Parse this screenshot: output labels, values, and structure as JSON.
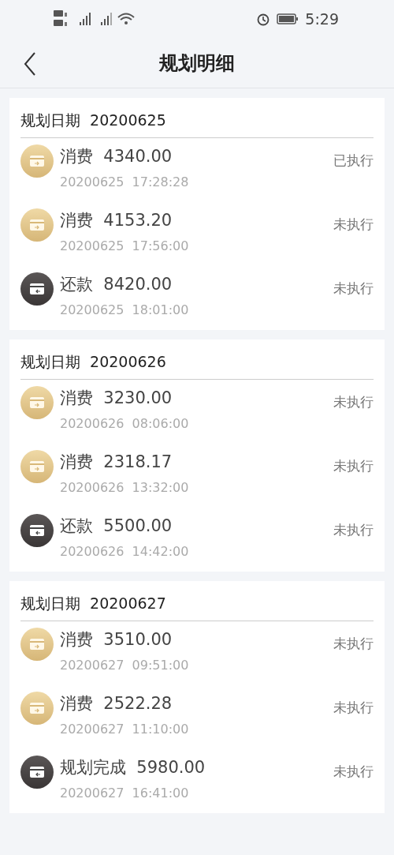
{
  "status_bar": {
    "time": "5:29"
  },
  "header": {
    "title": "规划明细"
  },
  "groups": [
    {
      "label": "规划日期",
      "date": "20200625",
      "items": [
        {
          "kind": "spend",
          "type": "消费",
          "amount": "4340.00",
          "date": "20200625",
          "time": "17:28:28",
          "status": "已执行"
        },
        {
          "kind": "spend",
          "type": "消费",
          "amount": "4153.20",
          "date": "20200625",
          "time": "17:56:00",
          "status": "未执行"
        },
        {
          "kind": "repay",
          "type": "还款",
          "amount": "8420.00",
          "date": "20200625",
          "time": "18:01:00",
          "status": "未执行"
        }
      ]
    },
    {
      "label": "规划日期",
      "date": "20200626",
      "items": [
        {
          "kind": "spend",
          "type": "消费",
          "amount": "3230.00",
          "date": "20200626",
          "time": "08:06:00",
          "status": "未执行"
        },
        {
          "kind": "spend",
          "type": "消费",
          "amount": "2318.17",
          "date": "20200626",
          "time": "13:32:00",
          "status": "未执行"
        },
        {
          "kind": "repay",
          "type": "还款",
          "amount": "5500.00",
          "date": "20200626",
          "time": "14:42:00",
          "status": "未执行"
        }
      ]
    },
    {
      "label": "规划日期",
      "date": "20200627",
      "items": [
        {
          "kind": "spend",
          "type": "消费",
          "amount": "3510.00",
          "date": "20200627",
          "time": "09:51:00",
          "status": "未执行"
        },
        {
          "kind": "spend",
          "type": "消费",
          "amount": "2522.28",
          "date": "20200627",
          "time": "11:10:00",
          "status": "未执行"
        },
        {
          "kind": "repay",
          "type": "规划完成",
          "amount": "5980.00",
          "date": "20200627",
          "time": "16:41:00",
          "status": "未执行"
        }
      ]
    }
  ]
}
